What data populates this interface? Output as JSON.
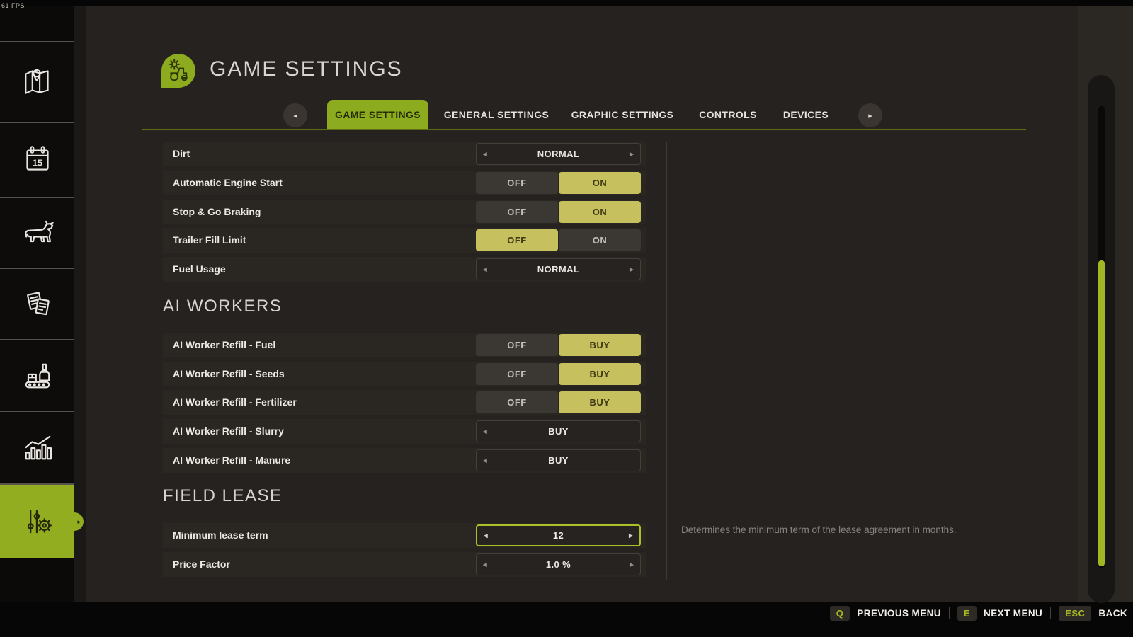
{
  "fps": "61 FPS",
  "header": {
    "title": "GAME SETTINGS"
  },
  "tabs": {
    "items": [
      "GAME SETTINGS",
      "GENERAL SETTINGS",
      "GRAPHIC SETTINGS",
      "CONTROLS",
      "DEVICES"
    ],
    "active_index": 0
  },
  "sidebar": {
    "items": [
      {
        "name": "map"
      },
      {
        "name": "calendar"
      },
      {
        "name": "animals"
      },
      {
        "name": "contracts"
      },
      {
        "name": "production"
      },
      {
        "name": "statistics"
      },
      {
        "name": "settings",
        "active": true
      }
    ],
    "calendar_day": "15"
  },
  "groups": [
    {
      "rows": [
        {
          "label": "Dirt",
          "type": "selector",
          "value": "NORMAL",
          "arrows": "both"
        },
        {
          "label": "Automatic Engine Start",
          "type": "toggle",
          "options": [
            "OFF",
            "ON"
          ],
          "active": 1
        },
        {
          "label": "Stop & Go Braking",
          "type": "toggle",
          "options": [
            "OFF",
            "ON"
          ],
          "active": 1
        },
        {
          "label": "Trailer Fill Limit",
          "type": "toggle",
          "options": [
            "OFF",
            "ON"
          ],
          "active": 0
        },
        {
          "label": "Fuel Usage",
          "type": "selector",
          "value": "NORMAL",
          "arrows": "both"
        }
      ]
    },
    {
      "title": "AI WORKERS",
      "rows": [
        {
          "label": "AI Worker Refill - Fuel",
          "type": "toggle",
          "options": [
            "OFF",
            "BUY"
          ],
          "active": 1
        },
        {
          "label": "AI Worker Refill - Seeds",
          "type": "toggle",
          "options": [
            "OFF",
            "BUY"
          ],
          "active": 1
        },
        {
          "label": "AI Worker Refill - Fertilizer",
          "type": "toggle",
          "options": [
            "OFF",
            "BUY"
          ],
          "active": 1
        },
        {
          "label": "AI Worker Refill - Slurry",
          "type": "selector",
          "value": "BUY",
          "arrows": "left"
        },
        {
          "label": "AI Worker Refill - Manure",
          "type": "selector",
          "value": "BUY",
          "arrows": "left"
        }
      ]
    },
    {
      "title": "FIELD LEASE",
      "rows": [
        {
          "label": "Minimum lease term",
          "type": "selector",
          "value": "12",
          "arrows": "both",
          "focused": true
        },
        {
          "label": "Price Factor",
          "type": "selector",
          "value": "1.0 %",
          "arrows": "both"
        }
      ]
    }
  ],
  "tooltip": "Determines the minimum term of the lease agreement in months.",
  "footer": {
    "shortcuts": [
      {
        "key": "Q",
        "label": "PREVIOUS MENU"
      },
      {
        "key": "E",
        "label": "NEXT MENU"
      },
      {
        "key": "ESC",
        "label": "BACK"
      }
    ]
  },
  "icons": {
    "arrow_left": "◂",
    "arrow_right": "▸"
  },
  "colors": {
    "accent_green": "#8dab1e",
    "scrollbar_green": "#a0b822",
    "toggle_active": "#c6c05f",
    "row_bg": "#2a2622",
    "content_bg": "#262220",
    "sidebar_bg": "#0b0a09",
    "focus_border": "#a9c026"
  }
}
